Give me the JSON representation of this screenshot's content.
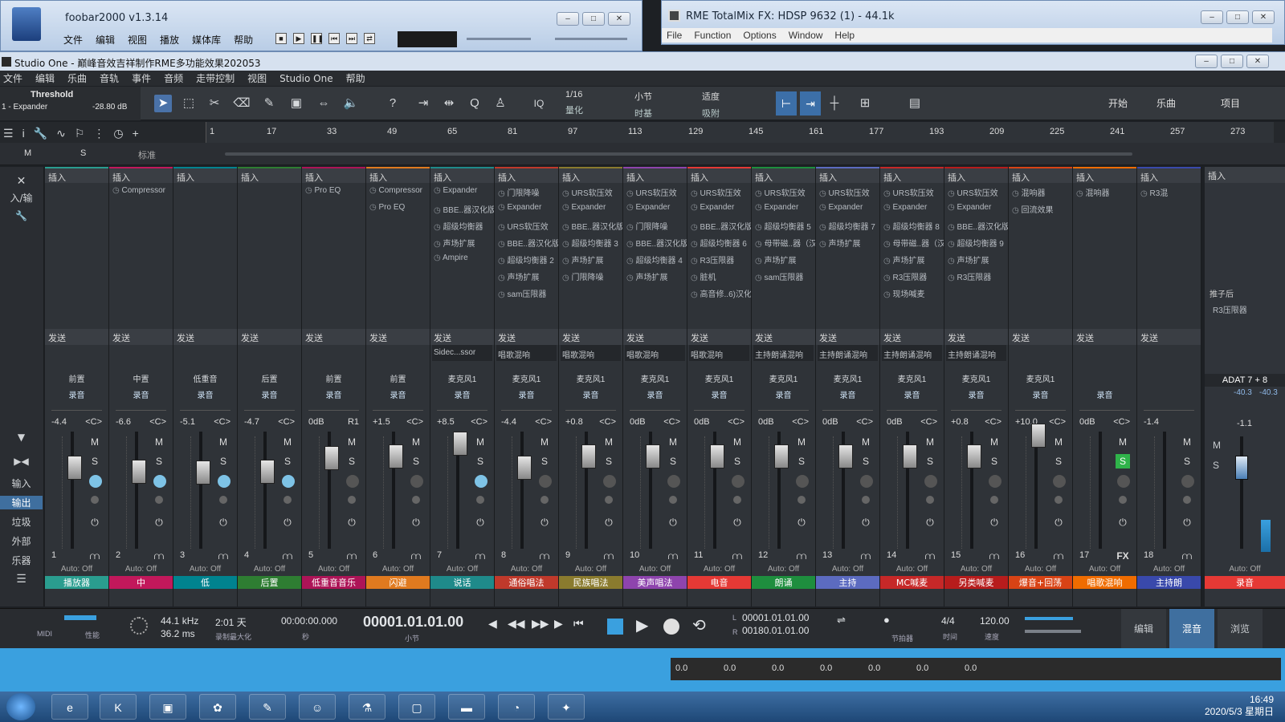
{
  "foobar": {
    "title": "foobar2000 v1.3.14",
    "menu": [
      "文件",
      "编辑",
      "视图",
      "播放",
      "媒体库",
      "帮助"
    ]
  },
  "rme": {
    "title": "RME TotalMix FX: HDSP 9632 (1) - 44.1k",
    "menu": [
      "File",
      "Function",
      "Options",
      "Window",
      "Help"
    ]
  },
  "studio": {
    "title": "Studio One - 巅峰音效吉祥制作RME多功能效果202053",
    "menu": [
      "文件",
      "编辑",
      "乐曲",
      "音轨",
      "事件",
      "音频",
      "走带控制",
      "视图",
      "Studio One",
      "帮助"
    ]
  },
  "toolbar": {
    "device_name": "Threshold",
    "device_sub": "1 - Expander",
    "device_val": "-28.80 dB",
    "quant": "1/16",
    "quant_sub": "量化",
    "timebase": "小节",
    "timebase_sub": "时基",
    "snap": "适度",
    "snap_sub": "吸附",
    "iq": "IQ",
    "start": "开始",
    "song": "乐曲",
    "project": "项目"
  },
  "ruler": {
    "ticks": [
      "1",
      "17",
      "33",
      "49",
      "65",
      "81",
      "97",
      "113",
      "129",
      "145",
      "161",
      "177",
      "193",
      "209",
      "225",
      "241",
      "257",
      "273"
    ],
    "sig": "4/4",
    "m": "M",
    "s": "S",
    "std": "标准"
  },
  "left": {
    "io": "入/输",
    "labels": [
      "输入",
      "输出",
      "垃圾",
      "外部",
      "乐器"
    ]
  },
  "channels": [
    {
      "n": "1",
      "out": "前置",
      "rec": "录音",
      "vol": "-4.4",
      "pan": "<C>",
      "ins": [],
      "send": "",
      "name": "播放器",
      "color": "#2a9d8f"
    },
    {
      "n": "2",
      "out": "中置",
      "rec": "录音",
      "vol": "-6.6",
      "pan": "<C>",
      "ins": [
        "Compressor"
      ],
      "send": "",
      "name": "中",
      "color": "#c2185b"
    },
    {
      "n": "3",
      "out": "低重音",
      "rec": "录音",
      "vol": "-5.1",
      "pan": "<C>",
      "ins": [],
      "send": "",
      "name": "低",
      "color": "#00838f"
    },
    {
      "n": "4",
      "out": "后置",
      "rec": "录音",
      "vol": "-4.7",
      "pan": "<C>",
      "ins": [],
      "send": "",
      "name": "后置",
      "color": "#2e7d32"
    },
    {
      "n": "5",
      "out": "前置",
      "rec": "录音",
      "vol": "0dB",
      "pan": "R1",
      "ins": [
        "Pro EQ"
      ],
      "send": "",
      "name": "低重音音乐",
      "color": "#ad1457"
    },
    {
      "n": "6",
      "out": "前置",
      "rec": "录音",
      "vol": "+1.5",
      "pan": "<C>",
      "ins": [
        "Compressor",
        "Pro EQ"
      ],
      "send": "",
      "name": "闪避",
      "color": "#e07a1f"
    },
    {
      "n": "7",
      "out": "麦克风1",
      "rec": "录音",
      "vol": "+8.5",
      "pan": "<C>",
      "ins": [
        "Expander",
        "BBE..器汉化版",
        "超级均衡器",
        "声场扩展",
        "Ampire"
      ],
      "send": "Sidec...ssor",
      "name": "说话",
      "color": "#1f8a8a"
    },
    {
      "n": "8",
      "out": "麦克风1",
      "rec": "录音",
      "vol": "-4.4",
      "pan": "<C>",
      "ins": [
        "门限降噪",
        "Expander",
        "URS软压效",
        "BBE..器汉化版",
        "超级均衡器 2",
        "声场扩展",
        "sam压限器"
      ],
      "send": "唱歌混响",
      "name": "通俗唱法",
      "color": "#c0392b"
    },
    {
      "n": "9",
      "out": "麦克风1",
      "rec": "录音",
      "vol": "+0.8",
      "pan": "<C>",
      "ins": [
        "URS软压效",
        "Expander",
        "BBE..器汉化版",
        "超级均衡器 3",
        "声场扩展",
        "门限降噪"
      ],
      "send": "唱歌混响",
      "name": "民族唱法",
      "color": "#8a7b2e"
    },
    {
      "n": "10",
      "out": "麦克风1",
      "rec": "录音",
      "vol": "0dB",
      "pan": "<C>",
      "ins": [
        "URS软压效",
        "Expander",
        "门限降噪",
        "BBE..器汉化版",
        "超级均衡器 4",
        "声场扩展"
      ],
      "send": "唱歌混响",
      "name": "美声唱法",
      "color": "#8e44ad"
    },
    {
      "n": "11",
      "out": "麦克风1",
      "rec": "录音",
      "vol": "0dB",
      "pan": "<C>",
      "ins": [
        "URS软压效",
        "Expander",
        "BBE..器汉化版",
        "超级均衡器 6",
        "R3压限器",
        "脏机",
        "高音修..6)汉化"
      ],
      "send": "唱歌混响",
      "name": "电音",
      "color": "#e53935"
    },
    {
      "n": "12",
      "out": "麦克风1",
      "rec": "录音",
      "vol": "0dB",
      "pan": "<C>",
      "ins": [
        "URS软压效",
        "Expander",
        "超级均衡器 5",
        "母带磁..器（汉",
        "声场扩展",
        "sam压限器"
      ],
      "send": "主持朗诵混响",
      "name": "朗诵",
      "color": "#1e8e3e"
    },
    {
      "n": "13",
      "out": "麦克风1",
      "rec": "录音",
      "vol": "0dB",
      "pan": "<C>",
      "ins": [
        "URS软压效",
        "Expander",
        "超级均衡器 7",
        "声场扩展"
      ],
      "send": "主持朗诵混响",
      "name": "主持",
      "color": "#5c6bc0"
    },
    {
      "n": "14",
      "out": "麦克风1",
      "rec": "录音",
      "vol": "0dB",
      "pan": "<C>",
      "ins": [
        "URS软压效",
        "Expander",
        "超级均衡器 8",
        "母带磁..器（汉",
        "声场扩展",
        "R3压限器",
        "现场喊麦"
      ],
      "send": "主持朗诵混响",
      "name": "MC喊麦",
      "color": "#c62828"
    },
    {
      "n": "15",
      "out": "麦克风1",
      "rec": "录音",
      "vol": "+0.8",
      "pan": "<C>",
      "ins": [
        "URS软压效",
        "Expander",
        "BBE..器汉化版",
        "超级均衡器 9",
        "声场扩展",
        "R3压限器"
      ],
      "send": "主持朗诵混响",
      "name": "另类喊麦",
      "color": "#b71c1c"
    },
    {
      "n": "16",
      "out": "麦克风1",
      "rec": "录音",
      "vol": "+10.0",
      "pan": "<C>",
      "ins": [
        "混响器",
        "回流效果"
      ],
      "send": "",
      "name": "爆音+回荡",
      "color": "#d84315"
    },
    {
      "n": "17",
      "out": "",
      "rec": "录音",
      "vol": "0dB",
      "pan": "<C>",
      "ins": [
        "混响器"
      ],
      "send": "",
      "name": "唱歌混响",
      "color": "#ef6c00"
    },
    {
      "n": "18",
      "out": "",
      "rec": "",
      "vol": "-1.4",
      "pan": "",
      "ins": [
        "R3混"
      ],
      "send": "",
      "name": "主持朗",
      "color": "#3949ab"
    }
  ],
  "labels": {
    "insert": "插入",
    "send": "发送",
    "auto": "Auto: Off",
    "m": "M",
    "s": "S",
    "fx": "FX"
  },
  "main": {
    "insert": "插入",
    "post": "推子后",
    "post_ins": "R3压限器",
    "out": "ADAT 7 + 8",
    "l": "-40.3",
    "r": "-40.3",
    "vol": "-1.1",
    "auto": "Auto: Off",
    "name": "录音",
    "color": "#e53935"
  },
  "transport": {
    "midi": "MIDI",
    "perf": "性能",
    "rate": "44.1 kHz",
    "lat": "36.2 ms",
    "rec_time": "2:01 天",
    "rec_label": "录制最大化",
    "time_sec": "00:00:00.000",
    "sec": "秒",
    "pos": "00001.01.01.00",
    "bar": "小节",
    "l": "00001.01.01.00",
    "r": "00180.01.01.00",
    "sig": "4/4",
    "sig_l": "时间",
    "tempo": "120.00",
    "tempo_l": "速度",
    "metro": "节拍器",
    "edit": "编辑",
    "mix": "混音",
    "browse": "浏览"
  },
  "rmebar": [
    "0.0",
    "0.0",
    "0.0",
    "0.0",
    "0.0",
    "0.0",
    "0.0"
  ],
  "taskbar": {
    "time": "16:49",
    "date": "2020/5/3 星期日"
  }
}
